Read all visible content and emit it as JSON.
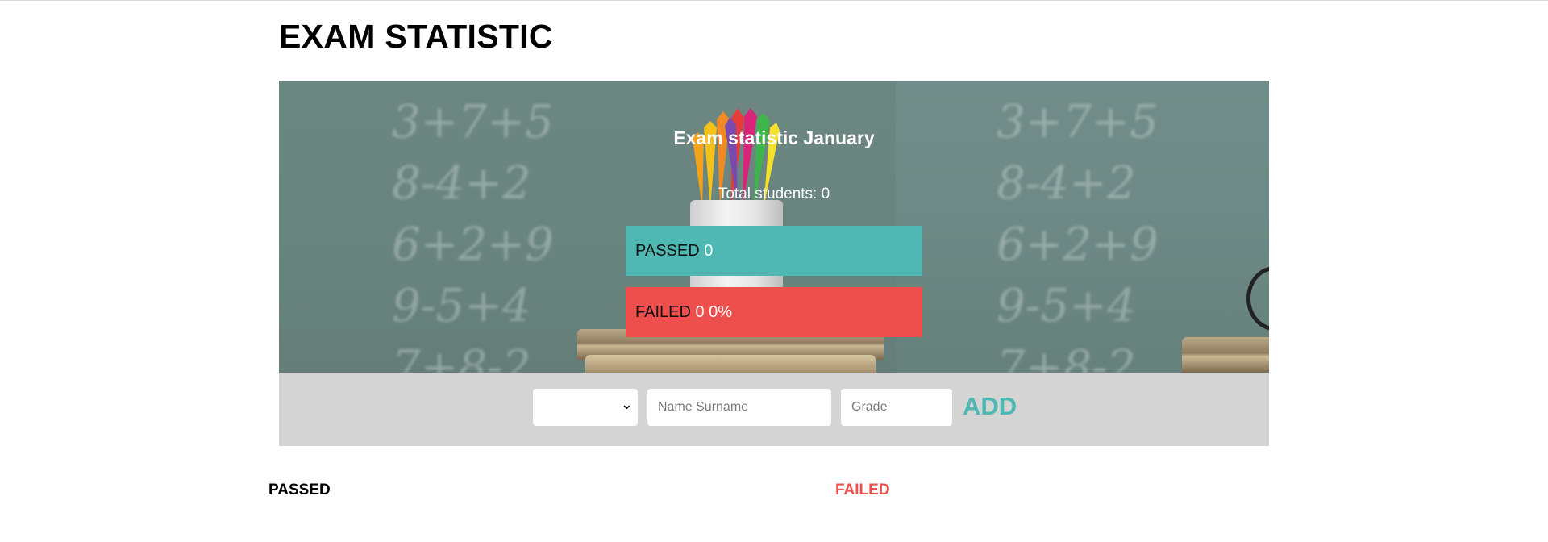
{
  "header": {
    "title": "EXAM STATISTIC"
  },
  "hero": {
    "title": "Exam statistic January",
    "total_label": "Total students: 0",
    "passed": {
      "label": "PASSED",
      "count": "0"
    },
    "failed": {
      "label": "FAILED",
      "count": "0",
      "percent": "0%"
    }
  },
  "form": {
    "select_value": "",
    "name_placeholder": "Name Surname",
    "grade_placeholder": "Grade",
    "add_label": "ADD"
  },
  "lists": {
    "passed_heading": "PASSED",
    "failed_heading": "FAILED"
  },
  "colors": {
    "passed": "#50b8b3",
    "failed": "#ee4f4d",
    "form_bg": "#d4d4d4"
  },
  "icons": {
    "select_arrow": "chevron-down-icon"
  }
}
